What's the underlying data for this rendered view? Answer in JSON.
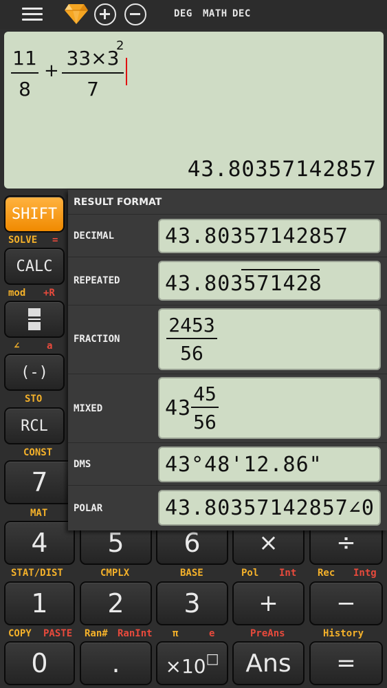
{
  "topbar": {
    "mode_deg": "DEG",
    "mode_math": "MATH",
    "mode_dec": "DEC"
  },
  "display": {
    "expr": {
      "frac1_num": "11",
      "frac1_den": "8",
      "plus": "+",
      "frac2_num": "33×3",
      "frac2_exp": "2",
      "frac2_den": "7"
    },
    "result": "43.80357142857"
  },
  "keys": {
    "shift": "SHIFT",
    "calc": "CALC",
    "neg": "(-)",
    "rcl": "RCL",
    "k7": "7",
    "k4": "4",
    "k5": "5",
    "k6": "6",
    "mul": "×",
    "div": "÷",
    "k1": "1",
    "k2": "2",
    "k3": "3",
    "add": "+",
    "sub": "−",
    "k0": "0",
    "dot": ".",
    "exp10": "×10",
    "exp10_sup": "□",
    "ans": "Ans",
    "eq": "="
  },
  "secondary": {
    "solve": "SOLVE",
    "solve_eq": "=",
    "mod": "mod",
    "plus_r": "+R",
    "angle": "∠",
    "a": "a",
    "sto": "STO",
    "const": "CONST",
    "mat": "MAT",
    "stat_dist": "STAT/DIST",
    "cmplx": "CMPLX",
    "base": "BASE",
    "pol": "Pol",
    "int": "Int",
    "rec": "Rec",
    "intg": "Intg",
    "copy": "COPY",
    "paste": "PASTE",
    "ran": "Ran#",
    "ranint": "RanInt",
    "pi": "π",
    "e": "e",
    "preans": "PreAns",
    "history": "History"
  },
  "result_format": {
    "title": "RESULT FORMAT",
    "decimal_label": "DECIMAL",
    "decimal_value": "43.80357142857",
    "repeated_label": "REPEATED",
    "repeated_value": "43.803571428",
    "fraction_label": "FRACTION",
    "fraction_num": "2453",
    "fraction_den": "56",
    "mixed_label": "MIXED",
    "mixed_whole": "43",
    "mixed_num": "45",
    "mixed_den": "56",
    "dms_label": "DMS",
    "dms_value": "43°48'12.86\"",
    "polar_label": "POLAR",
    "polar_value": "43.80357142857∠0"
  },
  "colors": {
    "accent_orange": "#f59a14",
    "secondary_yellow": "#f4b12a",
    "secondary_red": "#e84a3c",
    "display_bg": "#cfdcc5",
    "cursor_red": "#e01010"
  }
}
